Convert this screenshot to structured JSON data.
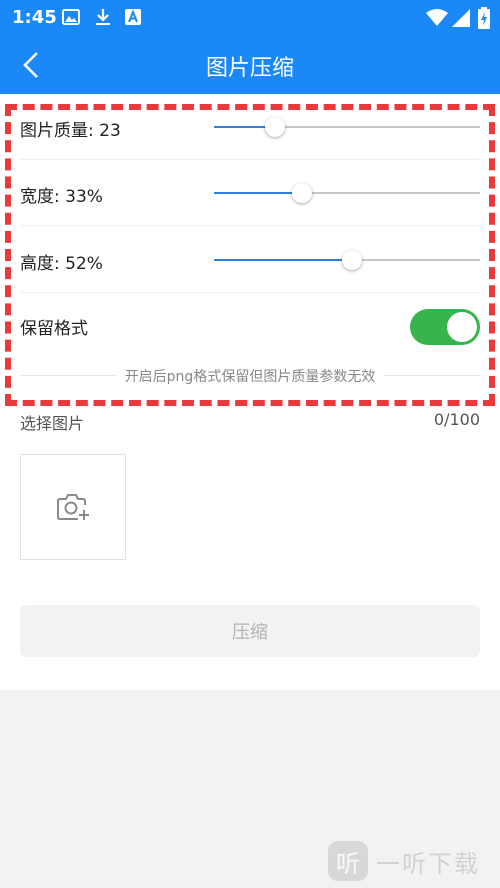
{
  "status": {
    "time": "1:45"
  },
  "header": {
    "title": "图片压缩"
  },
  "settings": {
    "quality": {
      "label": "图片质量: 23",
      "value": 23,
      "max": 100
    },
    "width": {
      "label": "宽度: 33%",
      "value": 33,
      "max": 100
    },
    "height": {
      "label": "高度: 52%",
      "value": 52,
      "max": 100
    },
    "keep_format": {
      "label": "保留格式",
      "on": true
    }
  },
  "hint": "开启后png格式保留但图片质量参数无效",
  "images": {
    "label": "选择图片",
    "count": "0/100"
  },
  "compress_label": "压缩",
  "watermark": {
    "logo": "听",
    "text": "一听下载"
  },
  "colors": {
    "accent": "#1a88f7",
    "toggle_on": "#35b54c",
    "slider": "#2f7fe0",
    "annotation": "#e83a3a"
  }
}
